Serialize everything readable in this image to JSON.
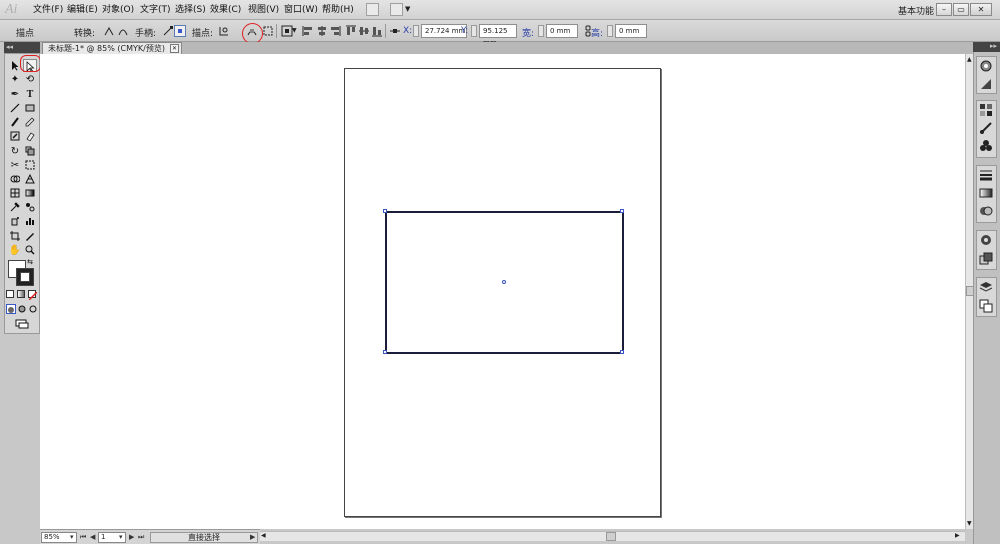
{
  "app": {
    "logo": "Ai"
  },
  "menu": {
    "items": [
      "文件(F)",
      "编辑(E)",
      "对象(O)",
      "文字(T)",
      "选择(S)",
      "效果(C)",
      "视图(V)",
      "窗口(W)",
      "帮助(H)"
    ],
    "workspace": "基本功能"
  },
  "control_bar": {
    "mode_label": "描点",
    "convert_label": "转换:",
    "handles_label": "手柄:",
    "anchors_label": "描点:",
    "x_label": "X:",
    "x_value": "27.724 mm",
    "y_label": "Y:",
    "y_value": "95.125 mm",
    "w_label": "宽:",
    "w_value": "0 mm",
    "h_label": "高:",
    "h_value": "0 mm"
  },
  "document": {
    "tab_title": "未标题-1* @ 85% (CMYK/预览)"
  },
  "status": {
    "zoom": "85%",
    "page": "1",
    "tool_name": "直接选择"
  },
  "colors": {
    "highlight": "#e02020",
    "selection": "#3a56c8",
    "shape_stroke": "#1b1d3a"
  }
}
